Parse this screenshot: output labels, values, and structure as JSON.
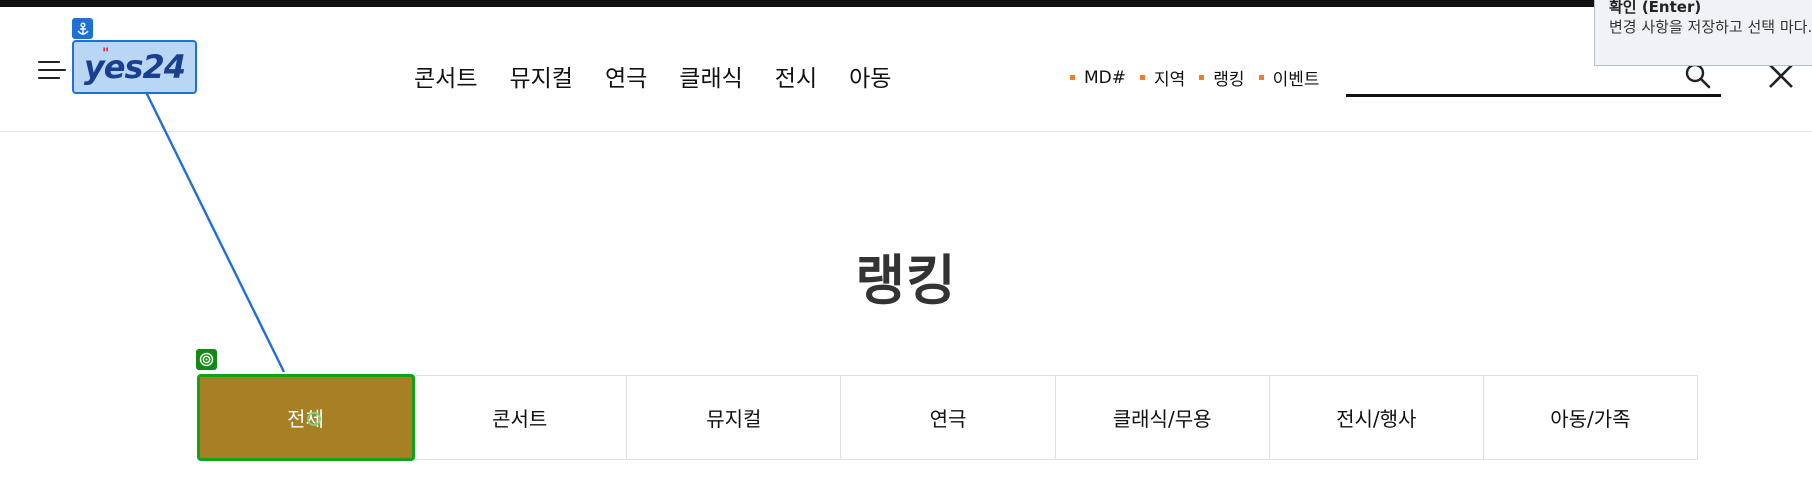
{
  "logo": {
    "text": "yes24",
    "dots": "\""
  },
  "nav": {
    "items": [
      "콘서트",
      "뮤지컬",
      "연극",
      "클래식",
      "전시",
      "아동"
    ]
  },
  "sub_links": [
    "MD#",
    "지역",
    "랭킹",
    "이벤트"
  ],
  "search": {
    "placeholder": ""
  },
  "tooltip": {
    "title": "확인 (Enter)",
    "body": "변경 사항을 저장하고 선택 마다."
  },
  "page": {
    "title": "랭킹"
  },
  "tabs": {
    "items": [
      "전체",
      "콘서트",
      "뮤지컬",
      "연극",
      "클래식/무용",
      "전시/행사",
      "아동/가족"
    ],
    "active_index": 0
  },
  "colors": {
    "accent_dot": "#f07d2e",
    "active_tab": "#a77f25",
    "anchor_badge": "#1f6fd6",
    "target_badge": "#138a13"
  }
}
